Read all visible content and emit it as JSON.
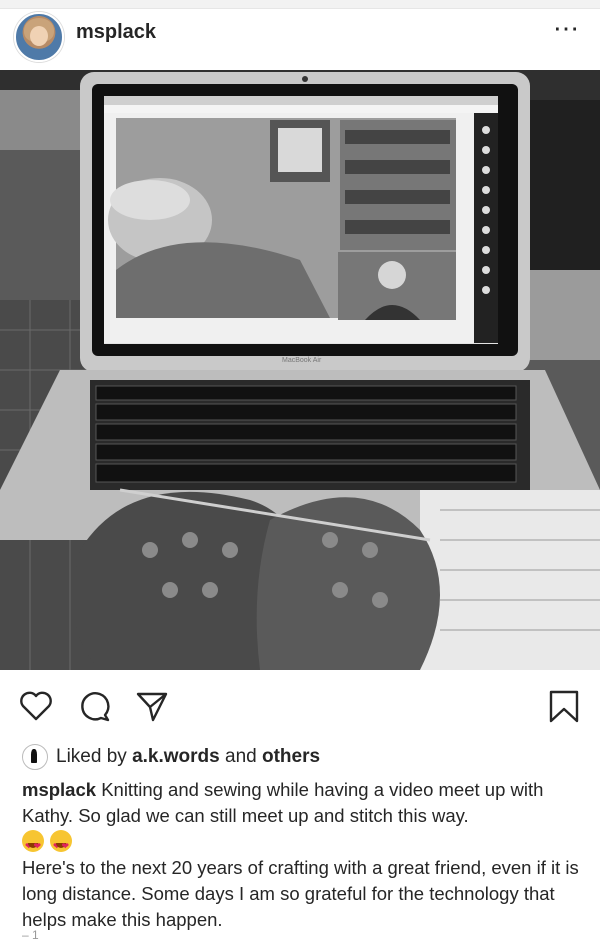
{
  "post": {
    "username": "msplack",
    "more_icon": "⋯",
    "likes": {
      "prefix": "Liked by",
      "user": "a.k.words",
      "conj": "and",
      "others": "others"
    },
    "caption": {
      "username": "msplack",
      "text1": "Knitting and sewing while having a video meet up with Kathy. So glad we can still meet up and stitch this way.",
      "text2": "Here's to the next 20 years of crafting with a great friend, even if it is long distance. Some days I am so grateful for the technology that helps make this happen."
    },
    "laptop_label": "MacBook Air",
    "cut_off_text": "– 1"
  },
  "icons": {
    "like": "heart-icon",
    "comment": "comment-icon",
    "share": "share-icon",
    "save": "bookmark-icon"
  }
}
